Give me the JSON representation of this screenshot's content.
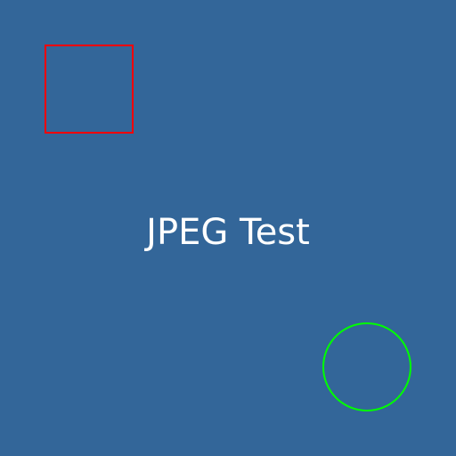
{
  "colors": {
    "background": "#336699",
    "square_outline": "#ff0000",
    "circle_outline": "#00ff00",
    "text": "#ffffff"
  },
  "label": {
    "text": "JPEG Test"
  }
}
